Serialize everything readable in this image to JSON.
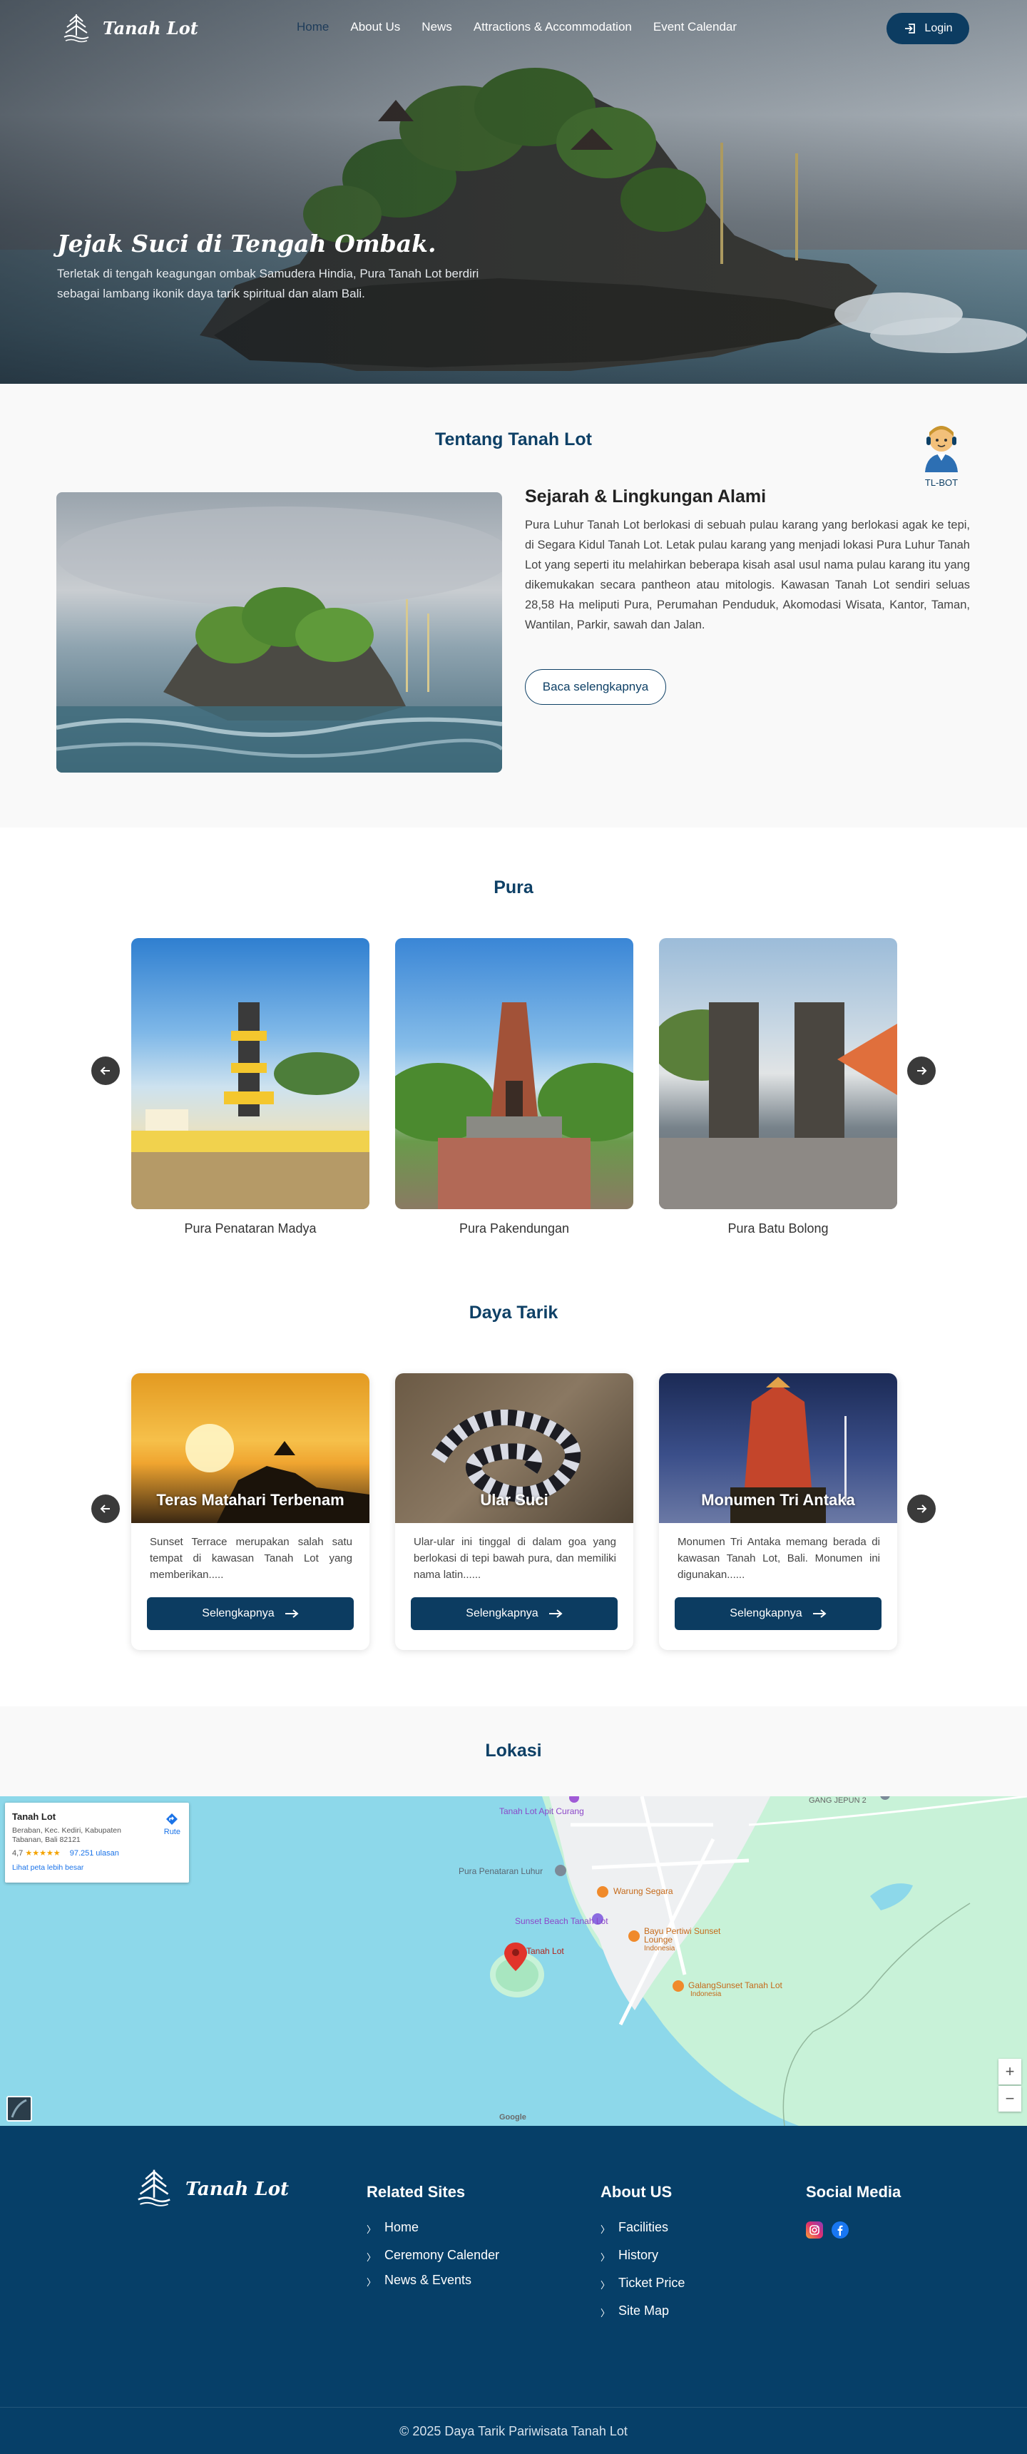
{
  "header": {
    "brand": "Tanah Lot",
    "nav": [
      "Home",
      "About Us",
      "News",
      "Attractions & Accommodation",
      "Event Calendar"
    ],
    "active_nav": "Home",
    "login_label": "Login"
  },
  "hero": {
    "title": "Jejak Suci di Tengah Ombak.",
    "subtitle": "Terletak di tengah keagungan ombak Samudera Hindia, Pura Tanah Lot berdiri sebagai lambang ikonik daya tarik spiritual dan alam Bali."
  },
  "about": {
    "section_title": "Tentang Tanah Lot",
    "heading": "Sejarah & Lingkungan Alami",
    "paragraph": "Pura Luhur Tanah Lot berlokasi di sebuah pulau karang yang berlokasi agak ke tepi, di Segara Kidul Tanah Lot. Letak pulau karang yang menjadi lokasi Pura Luhur Tanah Lot yang seperti itu melahirkan beberapa kisah asal usul nama pulau karang itu yang dikemukakan secara pantheon atau mitologis. Kawasan Tanah Lot sendiri seluas 28,58 Ha meliputi Pura, Perumahan Penduduk, Akomodasi Wisata, Kantor, Taman, Wantilan, Parkir, sawah dan Jalan.",
    "button": "Baca selengkapnya",
    "bot_label": "TL-BOT"
  },
  "pura": {
    "section_title": "Pura",
    "cards": [
      {
        "name": "Pura Penataran Madya"
      },
      {
        "name": "Pura Pakendungan"
      },
      {
        "name": "Pura Batu Bolong"
      }
    ]
  },
  "daya_tarik": {
    "section_title": "Daya Tarik",
    "button_label": "Selengkapnya",
    "cards": [
      {
        "title": "Teras Matahari Terbenam",
        "desc": "Sunset Terrace merupakan salah satu tempat di kawasan Tanah Lot yang memberikan....."
      },
      {
        "title": "Ular Suci",
        "desc": "Ular-ular ini tinggal di dalam goa yang berlokasi di tepi bawah pura, dan memiliki nama latin......"
      },
      {
        "title": "Monumen Tri Antaka",
        "desc": "Monumen Tri Antaka memang berada di kawasan Tanah Lot, Bali. Monumen ini digunakan......"
      }
    ]
  },
  "lokasi": {
    "section_title": "Lokasi",
    "map": {
      "place": "Tanah Lot",
      "address": "Beraban, Kec. Kediri, Kabupaten Tabanan, Bali 82121",
      "rating": "4,7",
      "stars": "★★★★★",
      "reviews": "97.251 ulasan",
      "link": "Lihat peta lebih besar",
      "route": "Rute",
      "labels": [
        "Tanah Lot Apit Curang",
        "Pura Penataran Luhur",
        "Warung Segara",
        "Sunset Beach Tanah Lot",
        "Tanah Lot",
        "Bayu Pertiwi Sunset Lounge",
        "Indonesia",
        "GalangSunset Tanah Lot",
        "Indonesia",
        "GANG JEPUN 2"
      ],
      "zoom_in": "+",
      "zoom_out": "−",
      "google": "Google"
    }
  },
  "footer": {
    "brand": "Tanah Lot",
    "related_title": "Related Sites",
    "related": [
      "Home",
      "Ceremony Calender",
      "News & Events"
    ],
    "about_title": "About US",
    "about": [
      "Facilities",
      "History",
      "Ticket Price",
      "Site Map"
    ],
    "social_title": "Social Media",
    "copyright": "© 2025 Daya Tarik Pariwisata Tanah Lot"
  },
  "colors": {
    "primary": "#0c3c61",
    "footer_bg": "#063f68",
    "section_bg": "#f9f9f9"
  }
}
